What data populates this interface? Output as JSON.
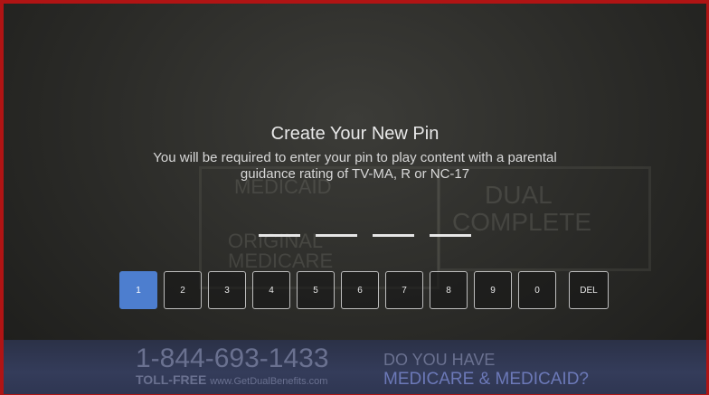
{
  "pin_setup": {
    "title": "Create Your New Pin",
    "subtitle_line1": "You will be required to enter your pin to play content with a parental",
    "subtitle_line2": "guidance rating of TV-MA, R or NC-17",
    "pin_length": 4,
    "selected_key": "1",
    "accent_color": "#4d7ecf"
  },
  "keypad": {
    "keys": [
      "1",
      "2",
      "3",
      "4",
      "5",
      "6",
      "7",
      "8",
      "9",
      "0",
      "DEL"
    ]
  },
  "background_ad": {
    "box_left_top": "MEDICAID",
    "box_left_bottom1": "ORIGINAL",
    "box_left_bottom2": "MEDICARE",
    "box_right1": "DUAL",
    "box_right2": "COMPLETE",
    "phone": "1-844-693-1433",
    "toll_free": "TOLL-FREE",
    "website": "www.GetDualBenefits.com",
    "question1": "DO YOU HAVE",
    "question2": "MEDICARE & MEDICAID?"
  }
}
